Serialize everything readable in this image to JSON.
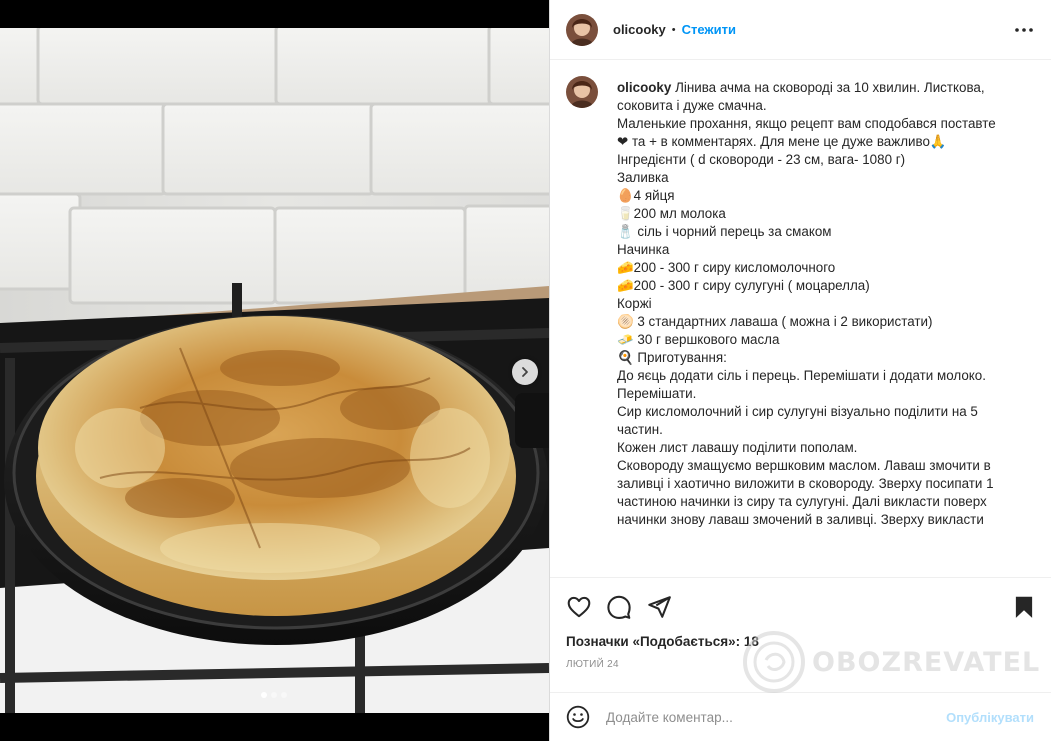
{
  "post": {
    "username": "olicooky",
    "separator": "•",
    "follow_label": "Стежити",
    "caption_lines": [
      "Лінива ачма на сковороді за 10 хвилин. Листкова,",
      "соковита і дуже смачна.",
      "",
      "Маленькие прохання, якщо рецепт вам сподобався поставте",
      "❤ та + в комментарях. Для мене це дуже важливо🙏",
      "",
      "Інгредієнти ( d сковороди - 23 см, вага- 1080 г)",
      "Заливка",
      "🥚4 яйця",
      "🥛200 мл молока",
      "🧂 сіль і чорний перець за смаком",
      "Начинка",
      "🧀200 - 300 г сиру кисломолочного",
      "🧀200 - 300 г сиру сулугуні ( моцарелла)",
      "Коржі",
      "🫓 3 стандартних лаваша ( можна і 2 використати)",
      "🧈 30 г вершкового масла",
      "",
      "🍳 Приготування:",
      "До яєць додати сіль і перець. Перемішати і додати молоко.",
      "Перемішати.",
      "Сир кисломолочний і сир сулугуні візуально поділити на 5",
      "частин.",
      "Кожен лист лавашу поділити пополам.",
      "Сковороду змащуємо вершковим маслом. Лаваш змочити в",
      "заливці і хаотично виложити в сковороду. Зверху посипати 1",
      "частиною начинки із сиру та сулугуні. Далі викласти поверх",
      "начинки знову лаваш змочений в заливці. Зверху викласти"
    ],
    "likes_text": "Позначки «Подобається»: 18",
    "date_text": "ЛЮТИЙ 24",
    "comment_placeholder": "Додайте коментар...",
    "publish_label": "Опублікувати",
    "carousel": {
      "total": 3,
      "active": 1
    },
    "watermark": "OBOZREVATEL"
  },
  "icons": {
    "more": "more-horizontal-icon",
    "like": "heart-icon",
    "comment": "comment-icon",
    "share": "paper-plane-icon",
    "save": "bookmark-icon",
    "emoji": "emoji-icon",
    "next": "chevron-right-icon"
  },
  "colors": {
    "link_blue": "#0095f6",
    "publish_disabled": "#b2dffc",
    "muted_text": "#8e8e8e",
    "border": "#efefef"
  }
}
